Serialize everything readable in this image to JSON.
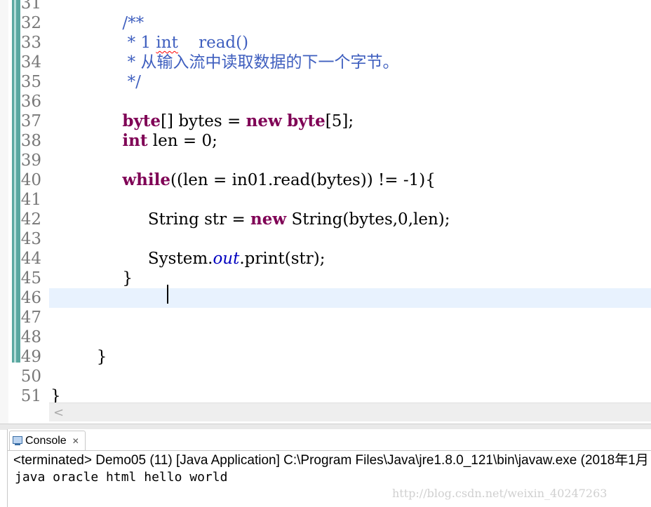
{
  "editor": {
    "lines": [
      {
        "n": "31",
        "html": ""
      },
      {
        "n": "32",
        "html": "<span class='cm'>              /**</span>"
      },
      {
        "n": "33",
        "html": "<span class='cm'>               * 1 <span class='squiggle'>int</span>    read()</span>"
      },
      {
        "n": "34",
        "html": "<span class='cm'>               * 从输入流中读取数据的下一个字节。</span>"
      },
      {
        "n": "35",
        "html": "<span class='cm'>               */</span>"
      },
      {
        "n": "36",
        "html": ""
      },
      {
        "n": "37",
        "html": "              <span class='kw'>byte</span>[] bytes = <span class='kw'>new</span> <span class='kw'>byte</span>[5];"
      },
      {
        "n": "38",
        "html": "              <span class='kw'>int</span> len = 0;"
      },
      {
        "n": "39",
        "html": ""
      },
      {
        "n": "40",
        "html": "              <span class='kw'>while</span>((len = in01.read(bytes)) != -1){"
      },
      {
        "n": "41",
        "html": ""
      },
      {
        "n": "42",
        "html": "                   String str = <span class='kw'>new</span> String(bytes,0,len);"
      },
      {
        "n": "43",
        "html": ""
      },
      {
        "n": "44",
        "html": "                   System.<span class='st'>out</span>.print(str);"
      },
      {
        "n": "45",
        "html": "              }"
      },
      {
        "n": "46",
        "html": ""
      },
      {
        "n": "47",
        "html": ""
      },
      {
        "n": "48",
        "html": ""
      },
      {
        "n": "49",
        "html": "         }"
      },
      {
        "n": "50",
        "html": ""
      },
      {
        "n": "51",
        "html": "}"
      }
    ],
    "current_line": "46"
  },
  "console": {
    "tab_label": "Console",
    "close_glyph": "✕",
    "status_line": "<terminated> Demo05 (11) [Java Application] C:\\Program Files\\Java\\jre1.8.0_121\\bin\\javaw.exe (2018年1月",
    "output": "java oracle html hello world",
    "watermark": "http://blog.csdn.net/weixin_40247263"
  },
  "scrollbar": {
    "left_arrow": "<"
  },
  "colors": {
    "keyword": "#7f0055",
    "comment": "#3f5fbf",
    "static_field": "#0000c0",
    "current_line": "#e8f2fe",
    "change_bar": "#5aa7a0"
  }
}
